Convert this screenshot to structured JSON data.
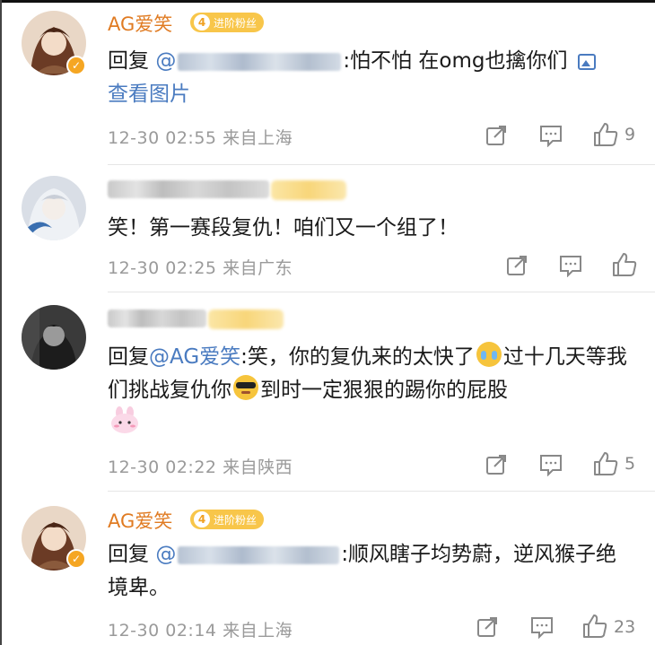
{
  "comments": [
    {
      "username": "AG爱笑",
      "fan_level": "4",
      "fan_label": "进阶粉丝",
      "reply_prefix": "回复",
      "at": "@",
      "text_after": ":怕不怕 在omg也擒你们",
      "view_image": "查看图片",
      "time": "12-30 02:55",
      "location": "来自上海",
      "likes": "9"
    },
    {
      "username": "",
      "text": "笑！第一赛段复仇！咱们又一个组了！",
      "time": "12-30 02:25",
      "location": "来自广东",
      "likes": ""
    },
    {
      "username": "",
      "reply_prefix": "回复",
      "at_name": "@AG爱笑",
      "text_part1": ":笑，你的复仇来的太快了",
      "text_part2": "过十几天等我们挑战复仇你",
      "text_part3": "到时一定狠狠的踢你的屁股",
      "time": "12-30 02:22",
      "location": "来自陕西",
      "likes": "5"
    },
    {
      "username": "AG爱笑",
      "fan_level": "4",
      "fan_label": "进阶粉丝",
      "reply_prefix": "回复",
      "at": "@",
      "text_after": ":顺风瞎子均势蔚，逆风猴子绝境卑。",
      "time": "12-30 02:14",
      "location": "来自上海",
      "likes": "23"
    }
  ],
  "icons": {
    "share": "share-icon",
    "comment": "comment-icon",
    "like": "thumbs-up-icon",
    "verified": "verified-badge-icon",
    "picture": "picture-icon"
  },
  "colors": {
    "username": "#e07b22",
    "link": "#4a7bc0",
    "meta": "#9a9a9a",
    "badge": "#f8c64a"
  }
}
